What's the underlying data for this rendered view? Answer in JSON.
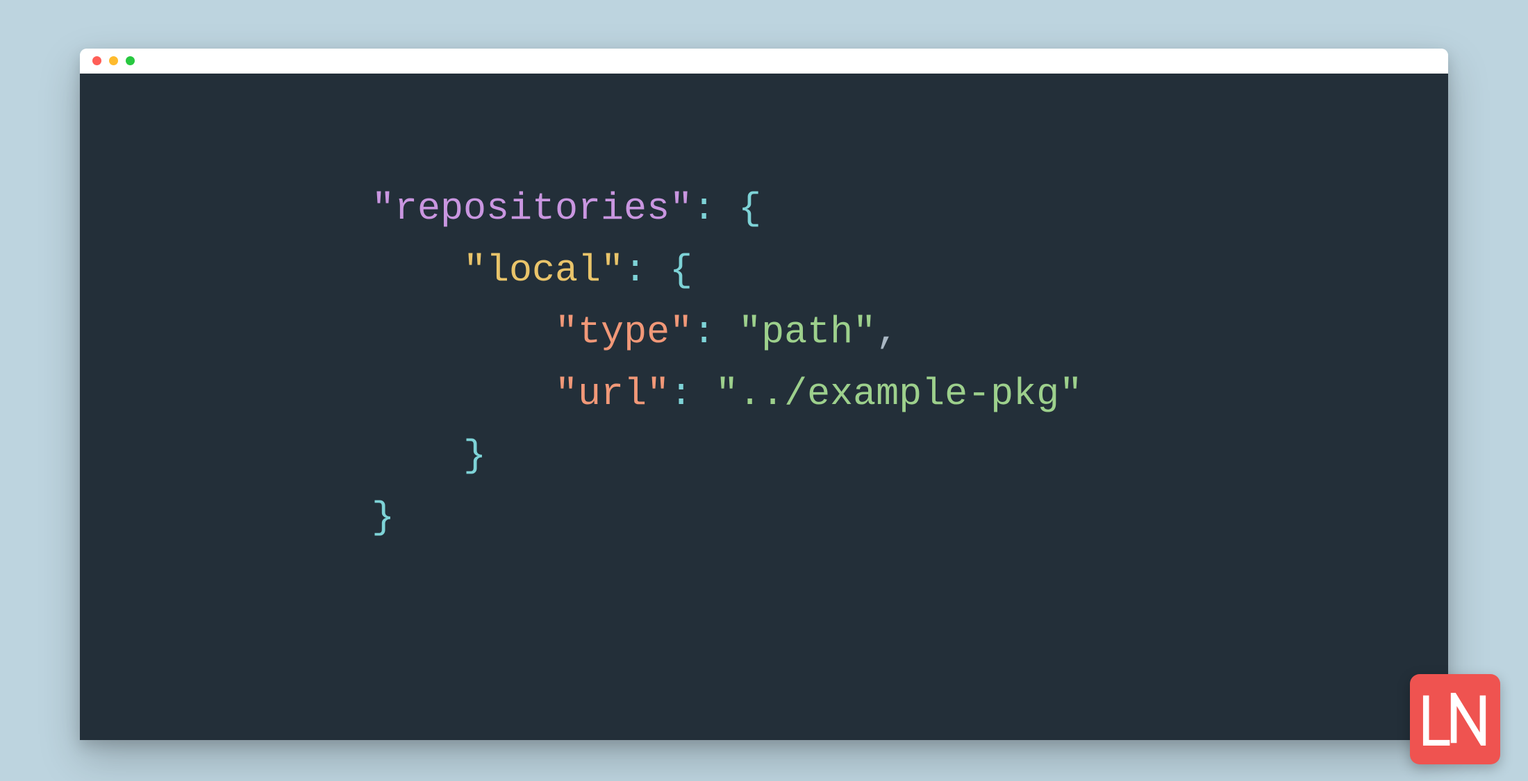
{
  "code": {
    "tokens": {
      "repositories_key": "\"repositories\"",
      "local_key": "\"local\"",
      "type_key": "\"type\"",
      "type_value": "\"path\"",
      "url_key": "\"url\"",
      "url_value": "\"../example-pkg\"",
      "colon": ":",
      "brace_open": "{",
      "brace_close": "}",
      "comma": ","
    }
  },
  "logo": {
    "text": "LN"
  },
  "colors": {
    "page_bg": "#bdd4df",
    "editor_bg": "#232f39",
    "purple": "#c996e0",
    "yellow": "#e9c46a",
    "coral": "#f19878",
    "green": "#9dd08c",
    "cyan": "#7ed3d7",
    "logo_bg": "#ef5350"
  }
}
